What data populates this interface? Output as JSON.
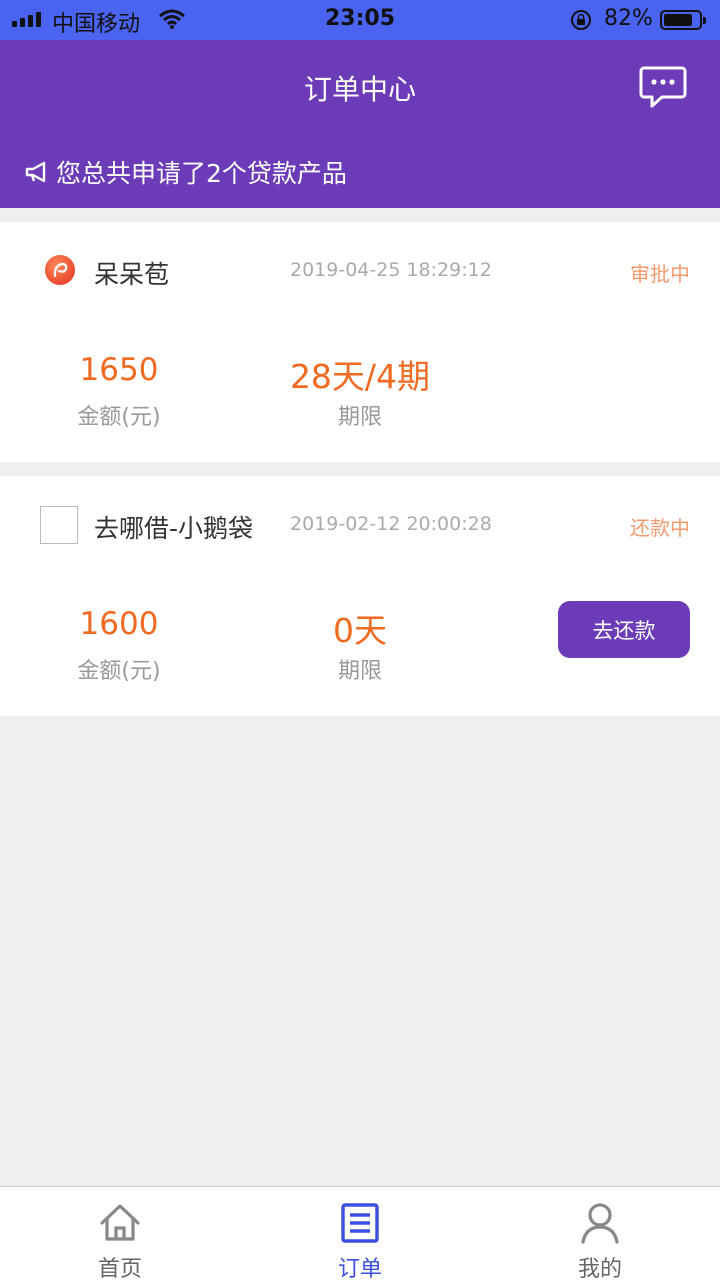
{
  "status_bar": {
    "carrier": "中国移动",
    "time": "23:05",
    "battery": "82%",
    "battery_level": 0.82,
    "icons": [
      "signal-icon",
      "wifi-icon",
      "rotation-lock-icon",
      "battery-icon"
    ]
  },
  "header": {
    "title": "订单中心",
    "message_icon": "chat-message-icon",
    "notice_icon": "megaphone-icon",
    "notice": "您总共申请了2个贷款产品"
  },
  "orders": [
    {
      "name": "呆呆苞",
      "logo": "orange-circle-logo",
      "date": "2019-04-25 18:29:12",
      "status": "审批中",
      "amount": "1650",
      "amount_label": "金额(元)",
      "term": "28天/4期",
      "term_label": "期限"
    },
    {
      "name": "去哪借-小鹅袋",
      "logo": "blank-logo-placeholder",
      "date": "2019-02-12 20:00:28",
      "status": "还款中",
      "amount": "1600",
      "amount_label": "金额(元)",
      "term": "0天",
      "term_label": "期限",
      "action": "去还款"
    }
  ],
  "tabs": [
    {
      "label": "首页",
      "icon": "home-icon",
      "active": false
    },
    {
      "label": "订单",
      "icon": "order-list-icon",
      "active": true
    },
    {
      "label": "我的",
      "icon": "profile-icon",
      "active": false
    }
  ],
  "colors": {
    "status_bar": "#4a63f0",
    "header": "#6b3bb8",
    "accent_orange": "#f06a22",
    "status_orange": "#f59a6e",
    "active_tab": "#3d4fe0"
  }
}
